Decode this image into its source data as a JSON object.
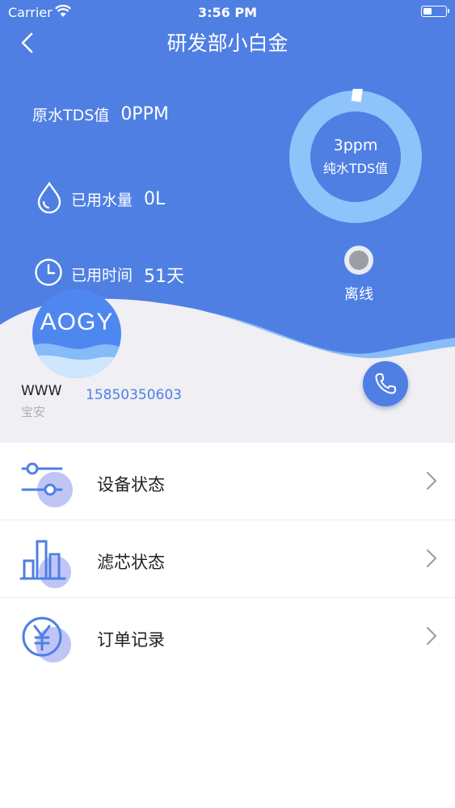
{
  "status_bar": {
    "carrier": "Carrier",
    "time": "3:56 PM",
    "battery_level": 0.35
  },
  "nav": {
    "title": "研发部小白金",
    "back_icon": "chevron-left-icon"
  },
  "raw_tds": {
    "label": "原水TDS值",
    "value": "0PPM"
  },
  "water_used": {
    "label": "已用水量",
    "value": "0L",
    "icon": "water-drop-icon"
  },
  "time_used": {
    "label": "已用时间",
    "value": "51天",
    "icon": "clock-icon"
  },
  "gauge": {
    "value": "3ppm",
    "label": "纯水TDS值",
    "ring_color": "#8FC4FB"
  },
  "device_status": {
    "label": "离线",
    "dot_color": "#9c9ea3"
  },
  "user": {
    "logo_text": "AOGY",
    "name": "WWW",
    "location": "宝安",
    "phone": "15850350603"
  },
  "colors": {
    "primary": "#4F7FE3",
    "accent_light": "#BFC6F6"
  },
  "menu": [
    {
      "label": "设备状态",
      "icon": "sliders-icon"
    },
    {
      "label": "滤芯状态",
      "icon": "bar-chart-icon"
    },
    {
      "label": "订单记录",
      "icon": "yen-coin-icon"
    }
  ]
}
